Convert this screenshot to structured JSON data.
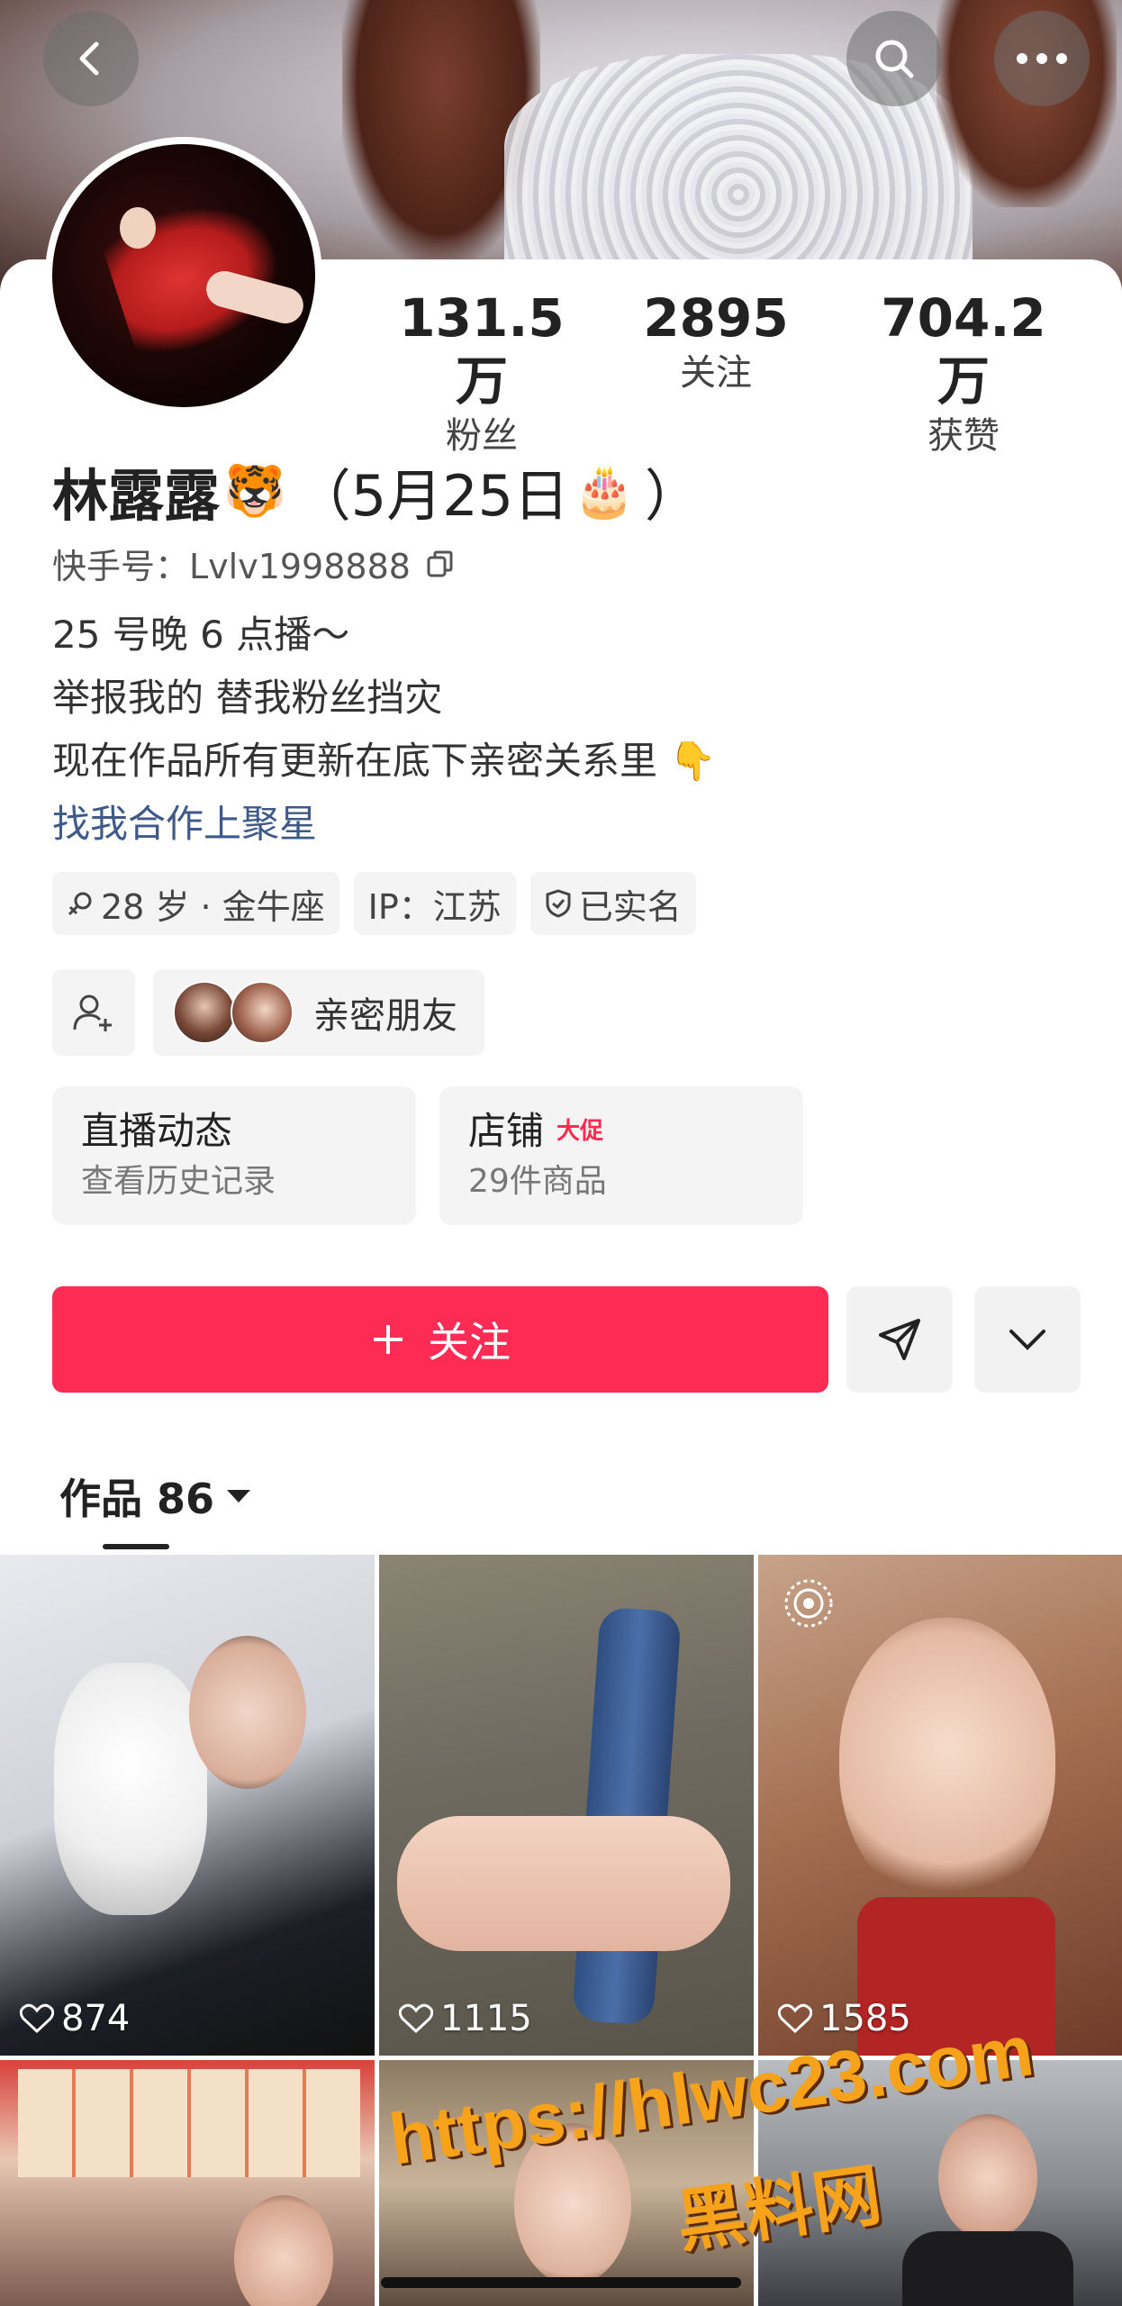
{
  "header": {
    "back_icon": "back-icon",
    "search_icon": "search-icon",
    "more_icon": "more-icon"
  },
  "stats": [
    {
      "value": "131.5万",
      "label": "粉丝"
    },
    {
      "value": "2895",
      "label": "关注"
    },
    {
      "value": "704.2万",
      "label": "获赞"
    }
  ],
  "profile": {
    "name": "林露露",
    "name_emoji": "🐯",
    "birthday": "（5月25日",
    "birthday_emoji": "🎂",
    "birthday_close": "）",
    "kuaishou_id": "快手号：Lvlv1998888",
    "bio": [
      "25 号晚 6 点播～",
      "举报我的 替我粉丝挡灾",
      "现在作品所有更新在底下亲密关系里 👇"
    ],
    "bio_link": "找我合作上聚星"
  },
  "tags": [
    "28 岁 · 金牛座",
    "IP：江苏",
    "已实名"
  ],
  "friends": {
    "label": "亲密朋友"
  },
  "cards": [
    {
      "title": "直播动态",
      "sub": "查看历史记录"
    },
    {
      "title": "店铺",
      "badge": "大促",
      "sub": "29件商品"
    }
  ],
  "actions": {
    "follow_label": "关注"
  },
  "works": {
    "label": "作品 86"
  },
  "grid": [
    {
      "likes": "874"
    },
    {
      "likes": "1115"
    },
    {
      "likes": "1585"
    }
  ],
  "watermark": {
    "url": "https://hlwc23.com",
    "text": "黑料网"
  },
  "colors": {
    "accent": "#fe2c55",
    "link": "#3d5a8a"
  }
}
